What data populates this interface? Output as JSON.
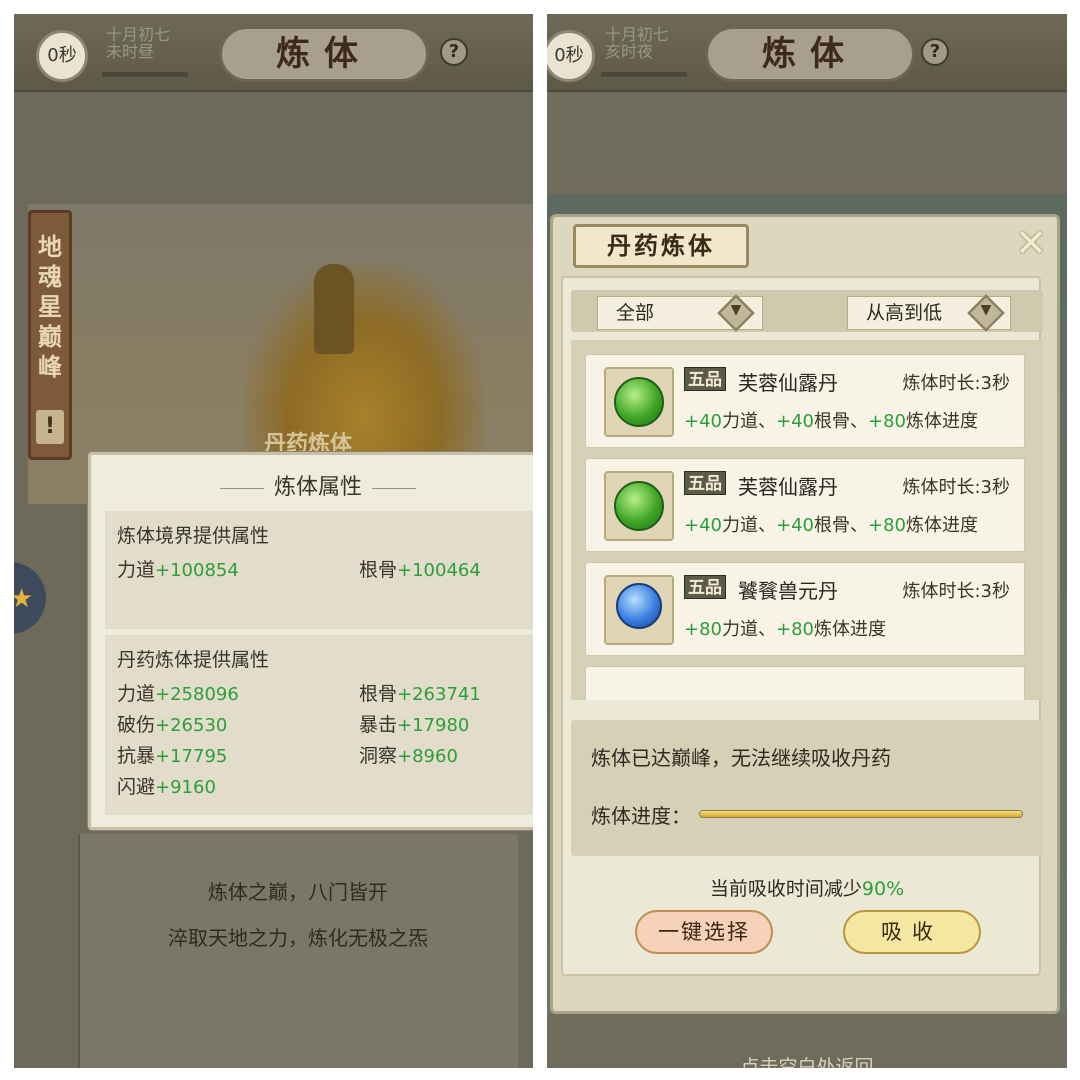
{
  "left": {
    "top": {
      "seconds": "0秒",
      "date_line1": "十月初七",
      "date_line2": "未时昼",
      "title": "炼体",
      "help": "?"
    },
    "side_banner": "地魂星巅峰",
    "side_alert": "!",
    "scene_label": "丹药炼体",
    "attr_panel": {
      "title": "炼体属性",
      "realm_section": {
        "heading": "炼体境界提供属性",
        "stats": [
          {
            "label": "力道",
            "value": "+100854"
          },
          {
            "label": "根骨",
            "value": "+100464"
          }
        ]
      },
      "pill_section": {
        "heading": "丹药炼体提供属性",
        "stats": [
          {
            "label": "力道",
            "value": "+258096"
          },
          {
            "label": "根骨",
            "value": "+263741"
          },
          {
            "label": "破伤",
            "value": "+26530"
          },
          {
            "label": "暴击",
            "value": "+17980"
          },
          {
            "label": "抗暴",
            "value": "+17795"
          },
          {
            "label": "洞察",
            "value": "+8960"
          },
          {
            "label": "闪避",
            "value": "+9160"
          }
        ]
      }
    },
    "bottom_line1": "炼体之巅，八门皆开",
    "bottom_line2": "淬取天地之力，炼化无极之炁"
  },
  "right": {
    "top": {
      "seconds": "0秒",
      "date_line1": "十月初七",
      "date_line2": "亥时夜",
      "title": "炼体",
      "help": "?"
    },
    "modal": {
      "title": "丹药炼体",
      "close": "✕",
      "filter_left": "全部",
      "filter_right": "从高到低",
      "items": [
        {
          "grade": "五品",
          "name": "芙蓉仙露丹",
          "time": "炼体时长:3秒",
          "icon": "green-pill-icon",
          "desc": [
            {
              "t": "+40",
              "g": true
            },
            {
              "t": "力道、"
            },
            {
              "t": "+40",
              "g": true
            },
            {
              "t": "根骨、"
            },
            {
              "t": "+80",
              "g": true
            },
            {
              "t": "炼体进度"
            }
          ]
        },
        {
          "grade": "五品",
          "name": "芙蓉仙露丹",
          "time": "炼体时长:3秒",
          "icon": "green-pill-icon",
          "desc": [
            {
              "t": "+40",
              "g": true
            },
            {
              "t": "力道、"
            },
            {
              "t": "+40",
              "g": true
            },
            {
              "t": "根骨、"
            },
            {
              "t": "+80",
              "g": true
            },
            {
              "t": "炼体进度"
            }
          ]
        },
        {
          "grade": "五品",
          "name": "饕餮兽元丹",
          "time": "炼体时长:3秒",
          "icon": "blue-orb-icon",
          "desc": [
            {
              "t": "+80",
              "g": true
            },
            {
              "t": "力道、"
            },
            {
              "t": "+80",
              "g": true
            },
            {
              "t": "炼体进度"
            }
          ]
        }
      ],
      "status_message": "炼体已达巅峰，无法继续吸收丹药",
      "progress_label": "炼体进度：",
      "progress_value": 1.0,
      "reduce_prefix": "当前吸收时间减少",
      "reduce_value": "90%",
      "btn_select": "一键选择",
      "btn_absorb": "吸收"
    },
    "bottom_return": "点击空白处返回"
  },
  "colors": {
    "stat_green": "#2e9e3a",
    "progress_gold": "#d9a52b"
  }
}
